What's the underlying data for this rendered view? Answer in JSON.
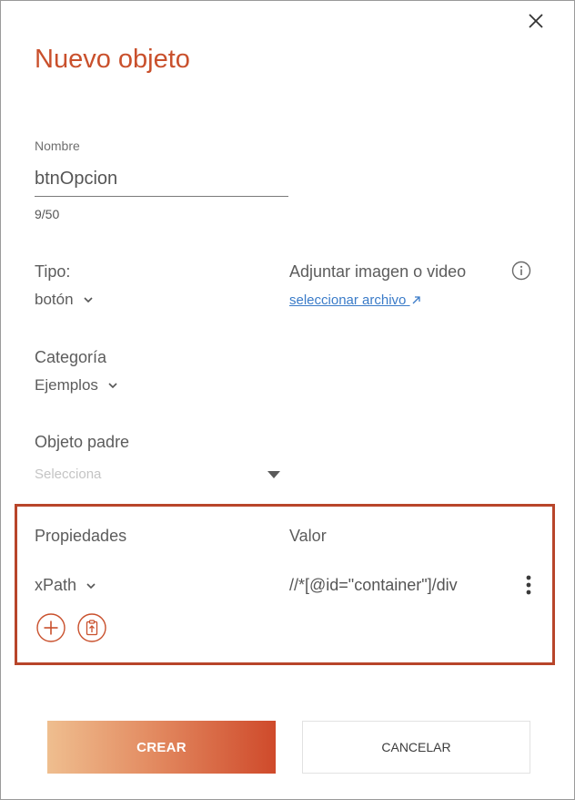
{
  "dialog": {
    "title": "Nuevo objeto",
    "close_icon": "close-icon"
  },
  "name_field": {
    "label": "Nombre",
    "value": "btnOpcion",
    "counter": "9/50"
  },
  "type_field": {
    "label": "Tipo:",
    "value": "botón"
  },
  "attachment": {
    "label": "Adjuntar imagen o video",
    "link_text": "seleccionar archivo",
    "link_icon": "external-link-icon",
    "info_icon": "info-icon"
  },
  "category_field": {
    "label": "Categoría",
    "value": "Ejemplos"
  },
  "parent_field": {
    "label": "Objeto padre",
    "placeholder": "Selecciona"
  },
  "properties": {
    "header_property": "Propiedades",
    "header_value": "Valor",
    "rows": [
      {
        "property": "xPath",
        "value": "//*[@id=\"container\"]/div"
      }
    ],
    "add_icon": "plus-circle-icon",
    "paste_icon": "clipboard-upload-icon",
    "highlight_color": "#b8452a"
  },
  "actions": {
    "create_label": "CREAR",
    "cancel_label": "CANCELAR"
  },
  "colors": {
    "accent": "#c9502c",
    "link": "#3a7bc8"
  }
}
